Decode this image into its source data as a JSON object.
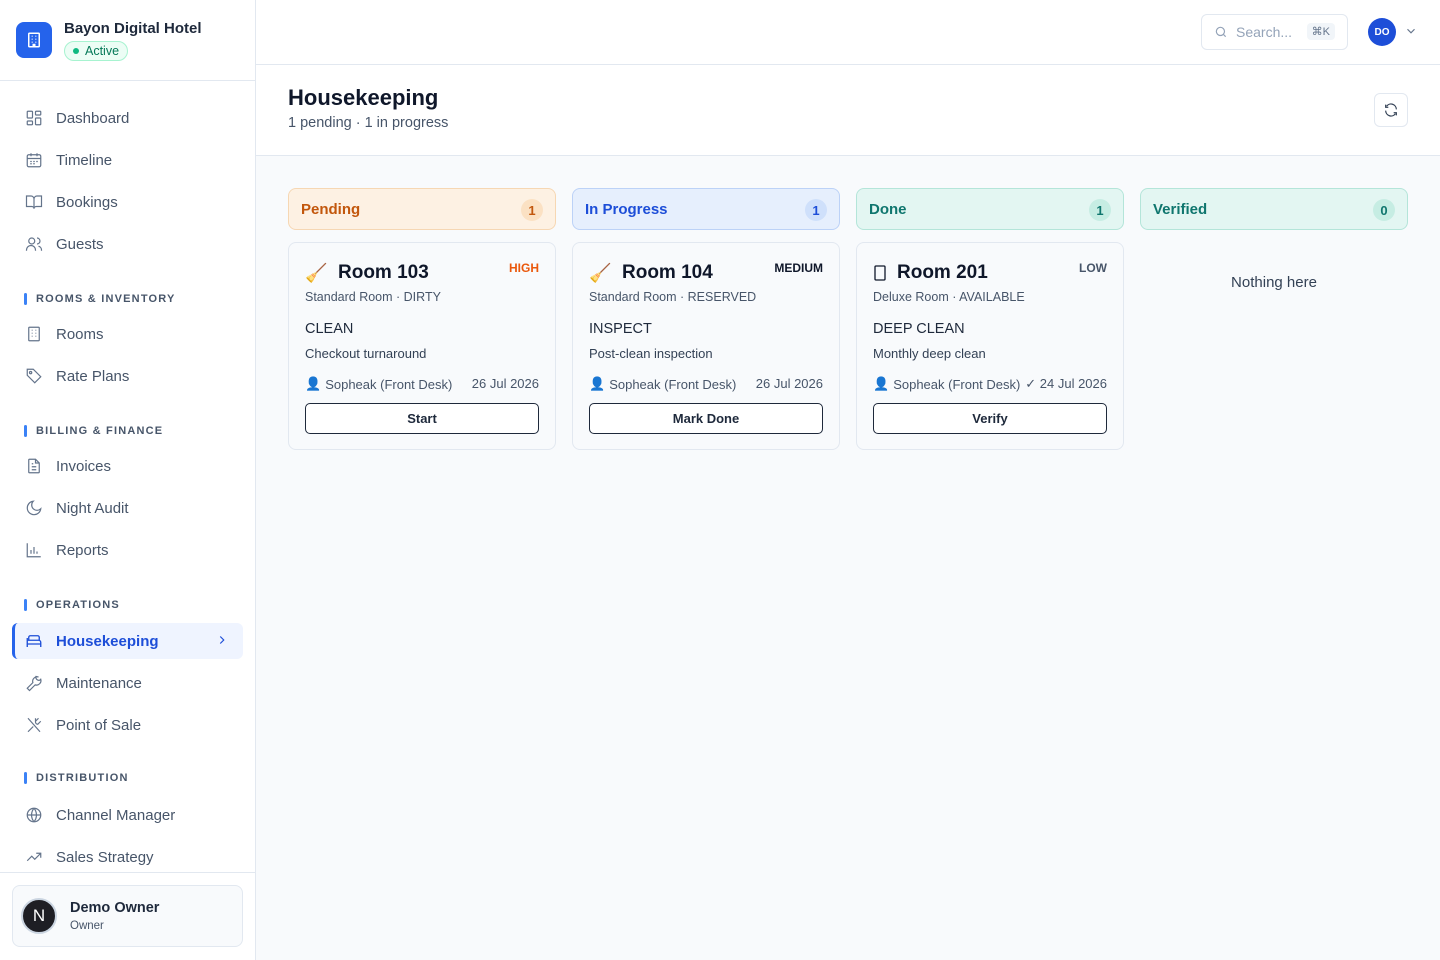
{
  "brand": {
    "name": "Bayon Digital Hotel",
    "status": "Active"
  },
  "nav": {
    "dashboard": "Dashboard",
    "timeline": "Timeline",
    "bookings": "Bookings",
    "guests": "Guests",
    "rooms_section": "ROOMS & INVENTORY",
    "rooms": "Rooms",
    "rate_plans": "Rate Plans",
    "billing_section": "BILLING & FINANCE",
    "invoices": "Invoices",
    "night_audit": "Night Audit",
    "reports": "Reports",
    "operations_section": "OPERATIONS",
    "housekeeping": "Housekeeping",
    "maintenance": "Maintenance",
    "pos": "Point of Sale",
    "distribution_section": "DISTRIBUTION",
    "channel_manager": "Channel Manager",
    "sales_strategy": "Sales Strategy"
  },
  "user": {
    "initial": "N",
    "name": "Demo Owner",
    "role": "Owner"
  },
  "topbar": {
    "search_placeholder": "Search...",
    "shortcut": "⌘K",
    "avatar_initials": "DO"
  },
  "page": {
    "title": "Housekeeping",
    "subtitle": "1 pending · 1 in progress"
  },
  "columns": {
    "pending": {
      "label": "Pending",
      "count": "1"
    },
    "in_progress": {
      "label": "In Progress",
      "count": "1"
    },
    "done": {
      "label": "Done",
      "count": "1"
    },
    "verified": {
      "label": "Verified",
      "count": "0",
      "empty_text": "Nothing here"
    }
  },
  "cards": [
    {
      "room": "Room 103",
      "priority": "HIGH",
      "priority_color": "#ea580c",
      "meta": "Standard Room · DIRTY",
      "task": "CLEAN",
      "note": "Checkout turnaround",
      "assignee": "Sopheak (Front Desk)",
      "date": "26 Jul 2026",
      "action": "Start"
    },
    {
      "room": "Room 104",
      "priority": "MEDIUM",
      "priority_color": "#0f172a",
      "meta": "Standard Room · RESERVED",
      "task": "INSPECT",
      "note": "Post-clean inspection",
      "assignee": "Sopheak (Front Desk)",
      "date": "26 Jul 2026",
      "action": "Mark Done"
    },
    {
      "room": "Room 201",
      "priority": "LOW",
      "priority_color": "#475569",
      "meta": "Deluxe Room · AVAILABLE",
      "task": "DEEP CLEAN",
      "note": "Monthly deep clean",
      "assignee": "Sopheak (Front Desk)",
      "date": "✓ 24 Jul 2026",
      "action": "Verify"
    }
  ]
}
